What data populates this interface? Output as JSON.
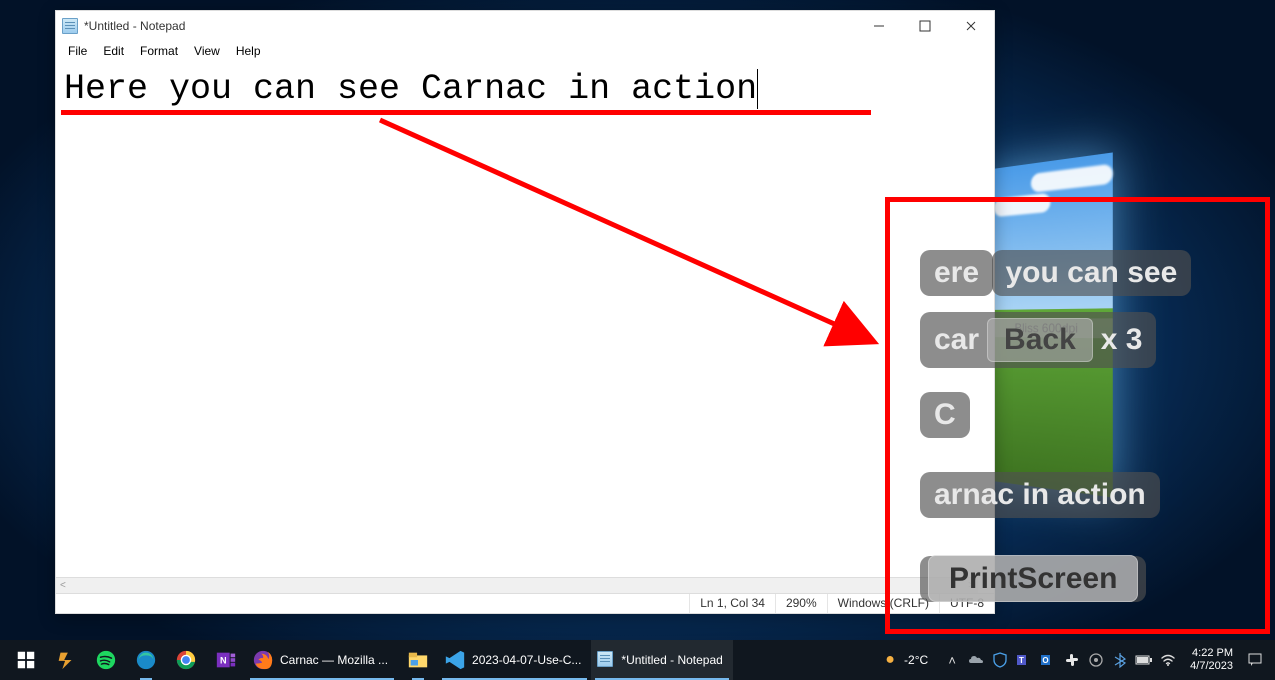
{
  "notepad": {
    "title": "*Untitled - Notepad",
    "menus": [
      "File",
      "Edit",
      "Format",
      "View",
      "Help"
    ],
    "text": "Here you can see Carnac in action",
    "status": {
      "pos": "Ln 1, Col 34",
      "zoom": "290%",
      "eol": "Windows (CRLF)",
      "encoding": "UTF-8"
    }
  },
  "carnac": {
    "line1_a": "ere",
    "line1_b": "you can see",
    "line2_a": "car",
    "line2_back": "Back",
    "line2_mult": "x 3",
    "line3": "C",
    "line4": "arnac in action",
    "line5": "PrintScreen"
  },
  "taskbar": {
    "firefox_title": "Carnac — Mozilla ...",
    "vscode_title": "2023-04-07-Use-C...",
    "notepad_title": "*Untitled - Notepad",
    "weather": "-2°C"
  },
  "clock": {
    "time": "4:22 PM",
    "date": "4/7/2023"
  },
  "bliss_label": "Bliss 600dpi"
}
